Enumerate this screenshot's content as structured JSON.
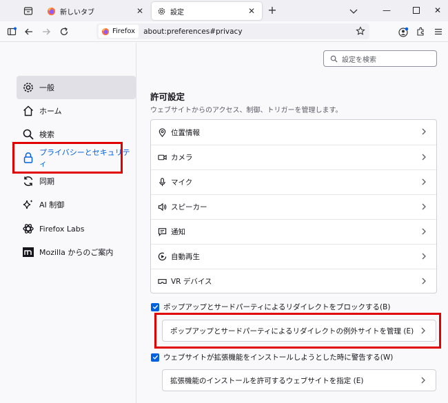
{
  "tabs": [
    {
      "title": "新しいタブ",
      "active": false
    },
    {
      "title": "設定",
      "active": true
    }
  ],
  "urlbar": {
    "identity_label": "Firefox",
    "url": "about:preferences#privacy"
  },
  "search": {
    "placeholder": "設定を検索"
  },
  "sidebar": {
    "items": [
      {
        "label": "一般",
        "icon": "gear-icon"
      },
      {
        "label": "ホーム",
        "icon": "home-icon"
      },
      {
        "label": "検索",
        "icon": "search-icon"
      },
      {
        "label": "プライバシーとセキュリティ",
        "icon": "lock-icon"
      },
      {
        "label": "同期",
        "icon": "sync-icon"
      },
      {
        "label": "AI 制御",
        "icon": "sparkle-icon"
      },
      {
        "label": "Firefox Labs",
        "icon": "flask-icon"
      },
      {
        "label": "Mozilla からのご案内",
        "icon": "mozilla-logo-icon"
      }
    ]
  },
  "permissions": {
    "heading": "許可設定",
    "description": "ウェブサイトからのアクセス、制御、トリガーを管理します。",
    "items": [
      {
        "label": "位置情報",
        "icon": "location-icon"
      },
      {
        "label": "カメラ",
        "icon": "camera-icon"
      },
      {
        "label": "マイク",
        "icon": "microphone-icon"
      },
      {
        "label": "スピーカー",
        "icon": "speaker-icon"
      },
      {
        "label": "通知",
        "icon": "notification-icon"
      },
      {
        "label": "自動再生",
        "icon": "autoplay-icon"
      },
      {
        "label": "VR デバイス",
        "icon": "vr-icon"
      }
    ],
    "popup_checkbox": "ポップアップとサードパーティによるリダイレクトをブロックする(B)",
    "popup_exceptions_button": "ポップアップとサードパーティによるリダイレクトの例外サイトを管理 (E)",
    "addon_checkbox": "ウェブサイトが拡張機能をインストールしようとした時に警告する(W)",
    "addon_exceptions_button": "拡張機能のインストールを許可するウェブサイトを指定 (E)"
  },
  "colors": {
    "accent": "#0061e0",
    "highlight_box": "#e00000"
  }
}
